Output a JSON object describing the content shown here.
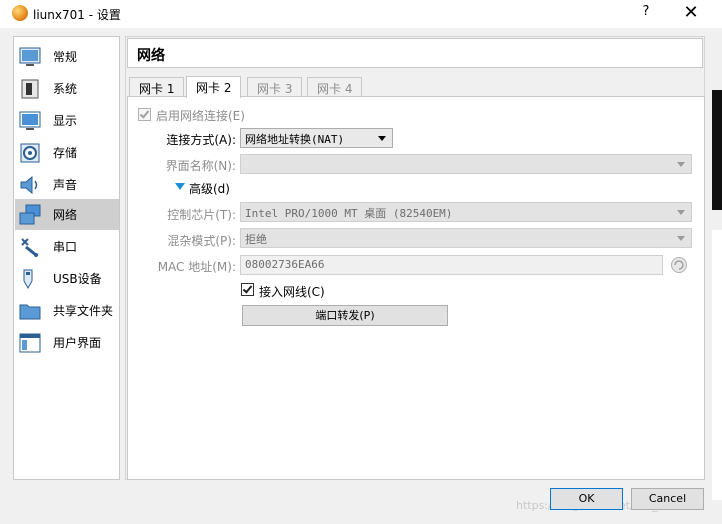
{
  "window": {
    "title": "liunx701 - 设置",
    "help_label": "?",
    "close_label": "✕"
  },
  "sidebar": {
    "items": [
      {
        "label": "常规",
        "icon": "general-icon"
      },
      {
        "label": "系统",
        "icon": "system-icon"
      },
      {
        "label": "显示",
        "icon": "display-icon"
      },
      {
        "label": "存储",
        "icon": "storage-icon"
      },
      {
        "label": "声音",
        "icon": "audio-icon"
      },
      {
        "label": "网络",
        "icon": "network-icon",
        "selected": true
      },
      {
        "label": "串口",
        "icon": "serial-port-icon"
      },
      {
        "label": "USB设备",
        "icon": "usb-icon"
      },
      {
        "label": "共享文件夹",
        "icon": "shared-folder-icon"
      },
      {
        "label": "用户界面",
        "icon": "user-interface-icon"
      }
    ]
  },
  "main": {
    "page_title": "网络",
    "tabs": [
      {
        "label": "网卡 1",
        "state": "normal"
      },
      {
        "label": "网卡 2",
        "state": "active"
      },
      {
        "label": "网卡 3",
        "state": "disabled"
      },
      {
        "label": "网卡 4",
        "state": "disabled"
      }
    ],
    "enable_adapter": {
      "label": "启用网络连接(E)",
      "checked": true,
      "disabled": true
    },
    "attached_to": {
      "label": "连接方式(A):",
      "value": "网络地址转换(NAT)"
    },
    "name": {
      "label": "界面名称(N):",
      "value": ""
    },
    "advanced": {
      "label": "高级(d)"
    },
    "adapter_type": {
      "label": "控制芯片(T):",
      "value": "Intel PRO/1000 MT 桌面 (82540EM)"
    },
    "promiscuous": {
      "label": "混杂模式(P):",
      "value": "拒绝"
    },
    "mac": {
      "label": "MAC 地址(M):",
      "value": "08002736EA66"
    },
    "cable_connected": {
      "label": "接入网线(C)",
      "checked": true
    },
    "port_forwarding": {
      "label": "端口转发(P)"
    }
  },
  "footer": {
    "ok_label": "OK",
    "cancel_label": "Cancel",
    "watermark": "https://blog.csdn.net/zsd_31"
  },
  "colors": {
    "selected_bg": "#cfcfcf",
    "ok_border": "#0078d7",
    "advanced_triangle": "#1a8fd9"
  }
}
